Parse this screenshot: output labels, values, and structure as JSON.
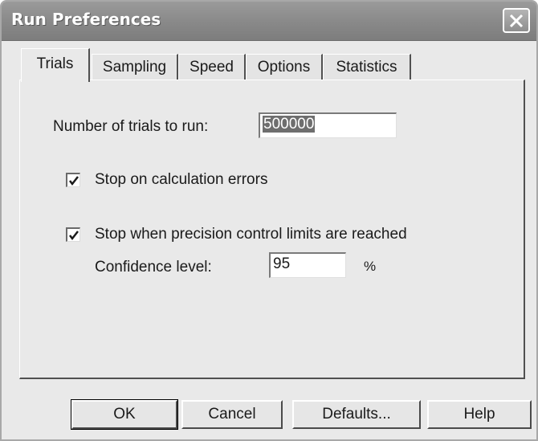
{
  "window": {
    "title": "Run Preferences",
    "close_icon": "close-x-icon"
  },
  "tabs": [
    {
      "label": "Trials",
      "active": true
    },
    {
      "label": "Sampling",
      "active": false
    },
    {
      "label": "Speed",
      "active": false
    },
    {
      "label": "Options",
      "active": false
    },
    {
      "label": "Statistics",
      "active": false
    }
  ],
  "trials": {
    "num_trials_label": "Number of trials to run:",
    "num_trials_value": "500000",
    "stop_calc_errors_label": "Stop on calculation errors",
    "stop_calc_errors_checked": true,
    "stop_precision_label": "Stop when precision control limits are reached",
    "stop_precision_checked": true,
    "confidence_label": "Confidence level:",
    "confidence_value": "95",
    "confidence_unit": "%"
  },
  "buttons": {
    "ok": "OK",
    "cancel": "Cancel",
    "defaults": "Defaults...",
    "help": "Help"
  }
}
